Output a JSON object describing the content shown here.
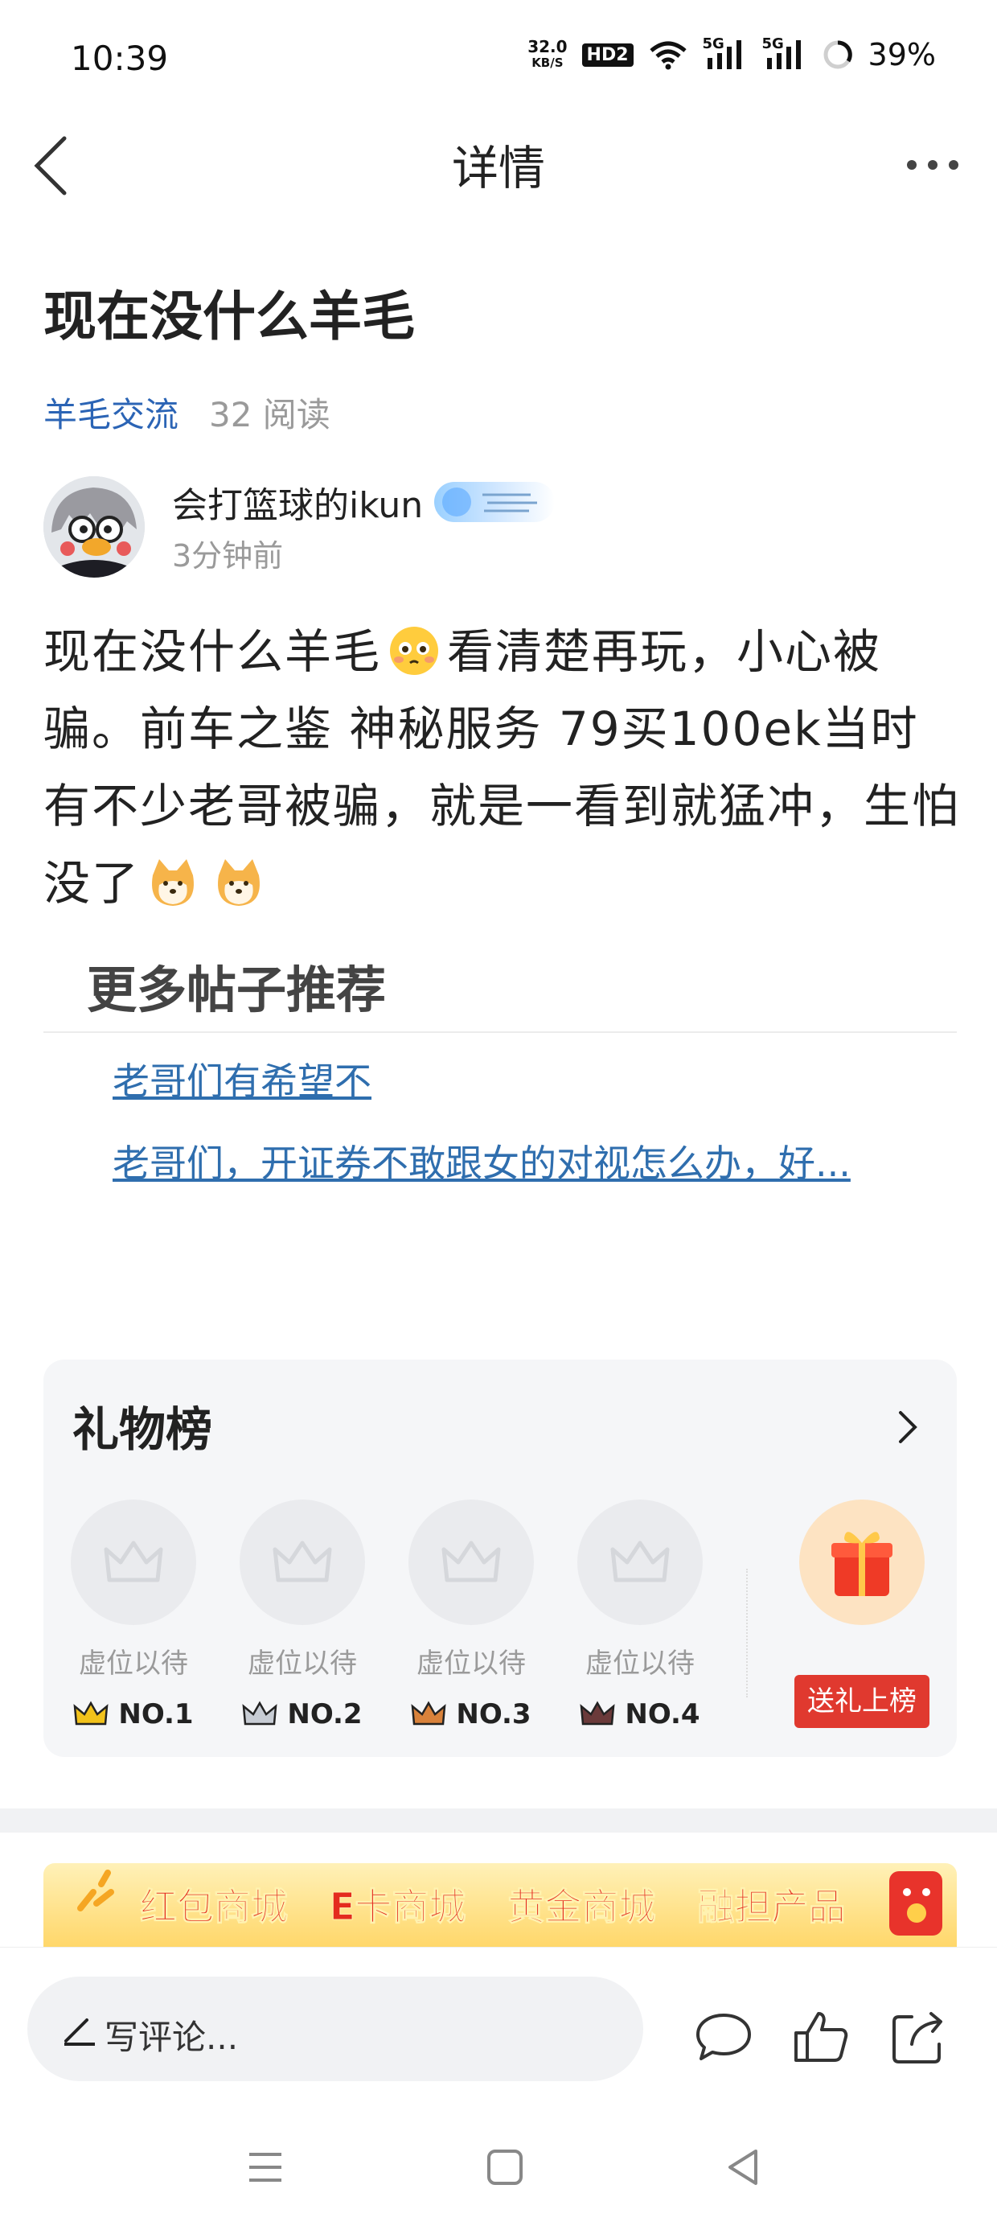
{
  "status_bar": {
    "time": "10:39",
    "net_speed_value": "32.0",
    "net_speed_unit": "KB/S",
    "hd_label": "HD2",
    "signal_1": "5G",
    "signal_2": "5G",
    "battery": "39%"
  },
  "header": {
    "title": "详情"
  },
  "post": {
    "title": "现在没什么羊毛",
    "forum": "羊毛交流",
    "reads": "32 阅读",
    "author_name": "会打篮球的ikun",
    "time_ago": "3分钟前",
    "body_part1": "现在没什么羊毛",
    "body_part2": "看清楚再玩，小心被骗。前车之鉴 神秘服务 79买100ek当时有不少老哥被骗，就是一看到就猛冲，生怕没了"
  },
  "more_posts": {
    "title": "更多帖子推荐",
    "items": [
      "老哥们有希望不",
      "老哥们，开证券不敢跟女的对视怎么办，好..."
    ]
  },
  "gift_board": {
    "title": "礼物榜",
    "slots": [
      {
        "label": "虚位以待",
        "rank": "NO.1",
        "crown_color": "#f2c21b"
      },
      {
        "label": "虚位以待",
        "rank": "NO.2",
        "crown_color": "#c7ccd4"
      },
      {
        "label": "虚位以待",
        "rank": "NO.3",
        "crown_color": "#d9823b"
      },
      {
        "label": "虚位以待",
        "rank": "NO.4",
        "crown_color": "#6b3a3a"
      }
    ],
    "send_button": "送礼上榜"
  },
  "banner": {
    "items": [
      "红包商城",
      "E卡商城",
      "黄金商城",
      "融担产品"
    ]
  },
  "bottom_bar": {
    "comment_placeholder": "写评论..."
  },
  "colors": {
    "link_blue": "#2b64b5",
    "send_red": "#e0392f",
    "banner_red": "#e42b1e"
  }
}
